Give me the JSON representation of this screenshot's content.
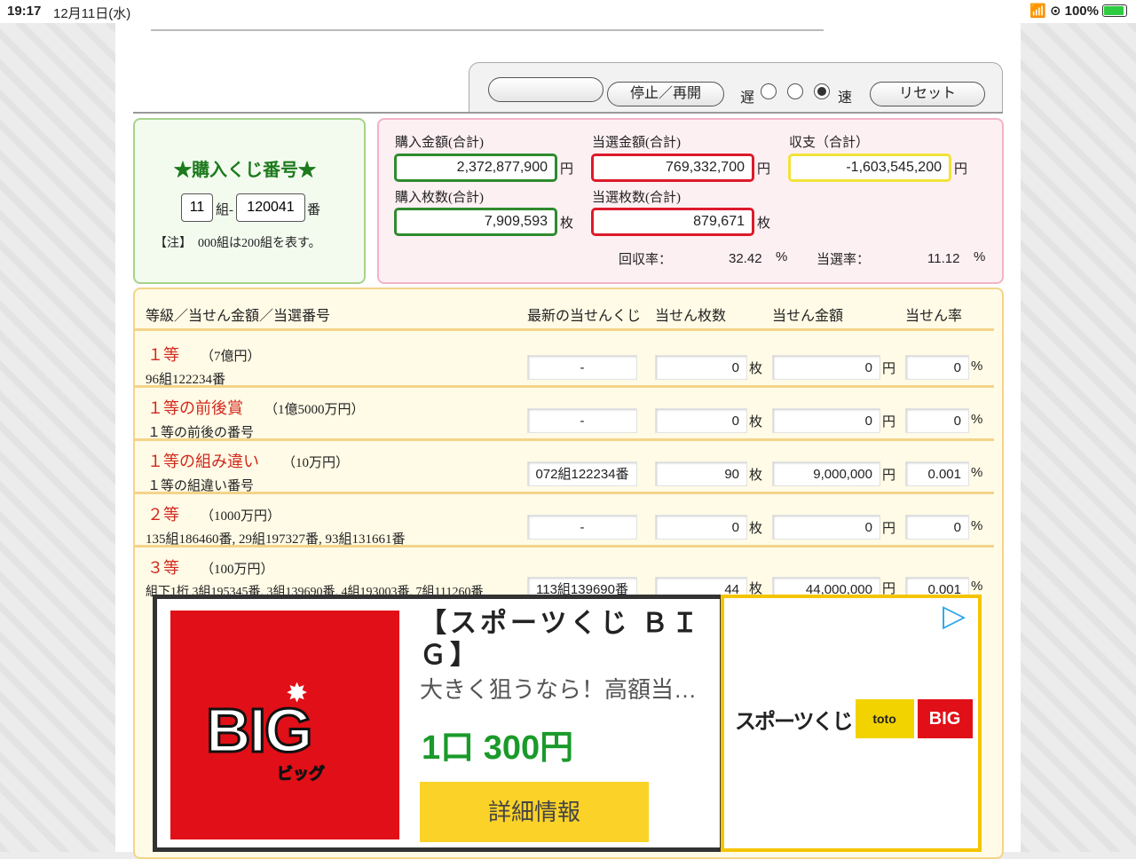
{
  "status": {
    "time": "19:17",
    "date": "12月11日(水)",
    "battery": "100%"
  },
  "controls": {
    "start_label": "",
    "stop_label": "停止／再開",
    "slow_label": "遅",
    "fast_label": "速",
    "reset_label": "リセット",
    "speed_selected": 3
  },
  "ticket": {
    "title": "★購入くじ番号★",
    "group_value": "11",
    "group_suffix": "組-",
    "number_value": "120041",
    "number_suffix": "番",
    "note": "【注】　000組は200組を表す。"
  },
  "totals": {
    "purchase_amount_label": "購入金額(合計)",
    "purchase_amount": "2,372,877,900",
    "yen": "円",
    "win_amount_label": "当選金額(合計)",
    "win_amount": "769,332,700",
    "balance_label": "収支（合計）",
    "balance": "-1,603,545,200",
    "purchase_count_label": "購入枚数(合計)",
    "purchase_count": "7,909,593",
    "mai": "枚",
    "win_count_label": "当選枚数(合計)",
    "win_count": "879,671",
    "return_rate_label": "回収率：",
    "return_rate": "32.42",
    "pct": "%",
    "win_rate_label": "当選率：",
    "win_rate": "11.12"
  },
  "table": {
    "headers": [
      "等級／当せん金額／当選番号",
      "最新の当せんくじ",
      "当せん枚数",
      "当せん金額",
      "当せん率"
    ],
    "rows": [
      {
        "title": "１等",
        "amount": "（7億円）",
        "sub": "96組122234番",
        "latest": "-",
        "count": "0",
        "money": "0",
        "rate": "0"
      },
      {
        "title": "１等の前後賞",
        "amount": "（1億5000万円）",
        "sub": "１等の前後の番号",
        "latest": "-",
        "count": "0",
        "money": "0",
        "rate": "0"
      },
      {
        "title": "１等の組み違い",
        "amount": "（10万円）",
        "sub": "１等の組違い番号",
        "latest": "072組122234番",
        "count": "90",
        "money": "9,000,000",
        "rate": "0.001"
      },
      {
        "title": "２等",
        "amount": "（1000万円）",
        "sub": "135組186460番, 29組197327番, 93組131661番",
        "latest": "-",
        "count": "0",
        "money": "0",
        "rate": "0"
      },
      {
        "title": "３等",
        "amount": "（100万円）",
        "sub": "組下1桁 3組195345番, 3組139690番, 4組193003番, 7組111260番",
        "latest": "113組139690番",
        "count": "44",
        "money": "44,000,000",
        "rate": "0.001"
      }
    ],
    "unit_mai": "枚",
    "unit_yen": "円",
    "unit_pct": "%"
  },
  "ad": {
    "logo_text": "BIG",
    "logo_kana": "ビッグ",
    "title": "【スポーツくじ ＢＩＧ】",
    "desc": "大きく狙うなら！高額当…",
    "price": "1口 300円",
    "button": "詳細情報",
    "brand_text": "スポーツくじ",
    "brand_toto": "toto",
    "brand_big": "BIG"
  }
}
